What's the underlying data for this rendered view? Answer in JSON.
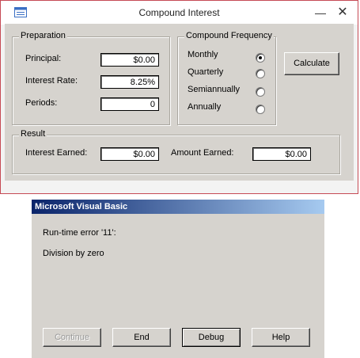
{
  "window": {
    "title": "Compound Interest",
    "minimize_glyph": "—",
    "close_glyph": "✕",
    "app_icon": "form-icon"
  },
  "preparation": {
    "legend": "Preparation",
    "principal_label": "Principal:",
    "principal_value": "$0.00",
    "rate_label": "Interest Rate:",
    "rate_value": "8.25%",
    "periods_label": "Periods:",
    "periods_value": "0"
  },
  "frequency": {
    "legend": "Compound Frequency",
    "options": [
      {
        "label": "Monthly",
        "selected": true
      },
      {
        "label": "Quarterly",
        "selected": false
      },
      {
        "label": "Semiannually",
        "selected": false
      },
      {
        "label": "Annually",
        "selected": false
      }
    ]
  },
  "calculate_label": "Calculate",
  "result": {
    "legend": "Result",
    "interest_label": "Interest Earned:",
    "interest_value": "$0.00",
    "amount_label": "Amount Earned:",
    "amount_value": "$0.00"
  },
  "error_dialog": {
    "title": "Microsoft Visual Basic",
    "line1": "Run-time error '11':",
    "line2": "Division by zero",
    "buttons": {
      "continue": "Continue",
      "end": "End",
      "debug": "Debug",
      "help": "Help"
    }
  }
}
